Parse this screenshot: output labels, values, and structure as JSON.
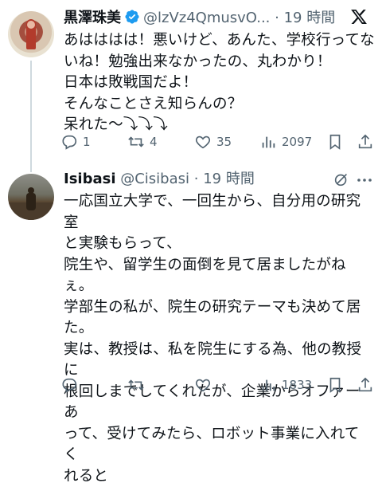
{
  "tweets": [
    {
      "author": {
        "name": "黒澤珠美",
        "handle": "@lzVz4QmusvO...",
        "verified": true
      },
      "time": "19 時間",
      "body": [
        "あはははは！悪いけど、あんた、学校行ってな",
        "いね！勉強出来なかったの、丸わかり！",
        "日本は敗戦国だよ！",
        "そんなことさえ知らんの？",
        "呆れた〜⤵︎⤵︎⤵︎"
      ],
      "stats": {
        "replies": "1",
        "reposts": "4",
        "likes": "35",
        "views": "2097"
      }
    },
    {
      "author": {
        "name": "Isibasi",
        "handle": "@Cisibasi",
        "verified": false
      },
      "time": "19 時間",
      "body": [
        "一応国立大学で、一回生から、自分用の研究室",
        "と実験もらって、",
        "院生や、留学生の面倒を見て居ましたがねぇ。",
        "学部生の私が、院生の研究テーマも決めて居",
        "た。",
        "実は、教授は、私を院生にする為、他の教授に",
        "根回しまでしてくれたが、企業からオファーあ",
        "って、受けてみたら、ロボット事業に入れてく",
        "れると"
      ],
      "stats": {
        "replies": "",
        "reposts": "",
        "likes": "",
        "views": "1833"
      }
    }
  ],
  "ui": {
    "separator": " · ",
    "accent": "#1d9bf0",
    "icons": [
      "reply-icon",
      "repost-icon",
      "like-icon",
      "views-icon",
      "bookmark-icon",
      "share-icon",
      "x-logo-icon",
      "grok-icon",
      "more-icon"
    ]
  }
}
